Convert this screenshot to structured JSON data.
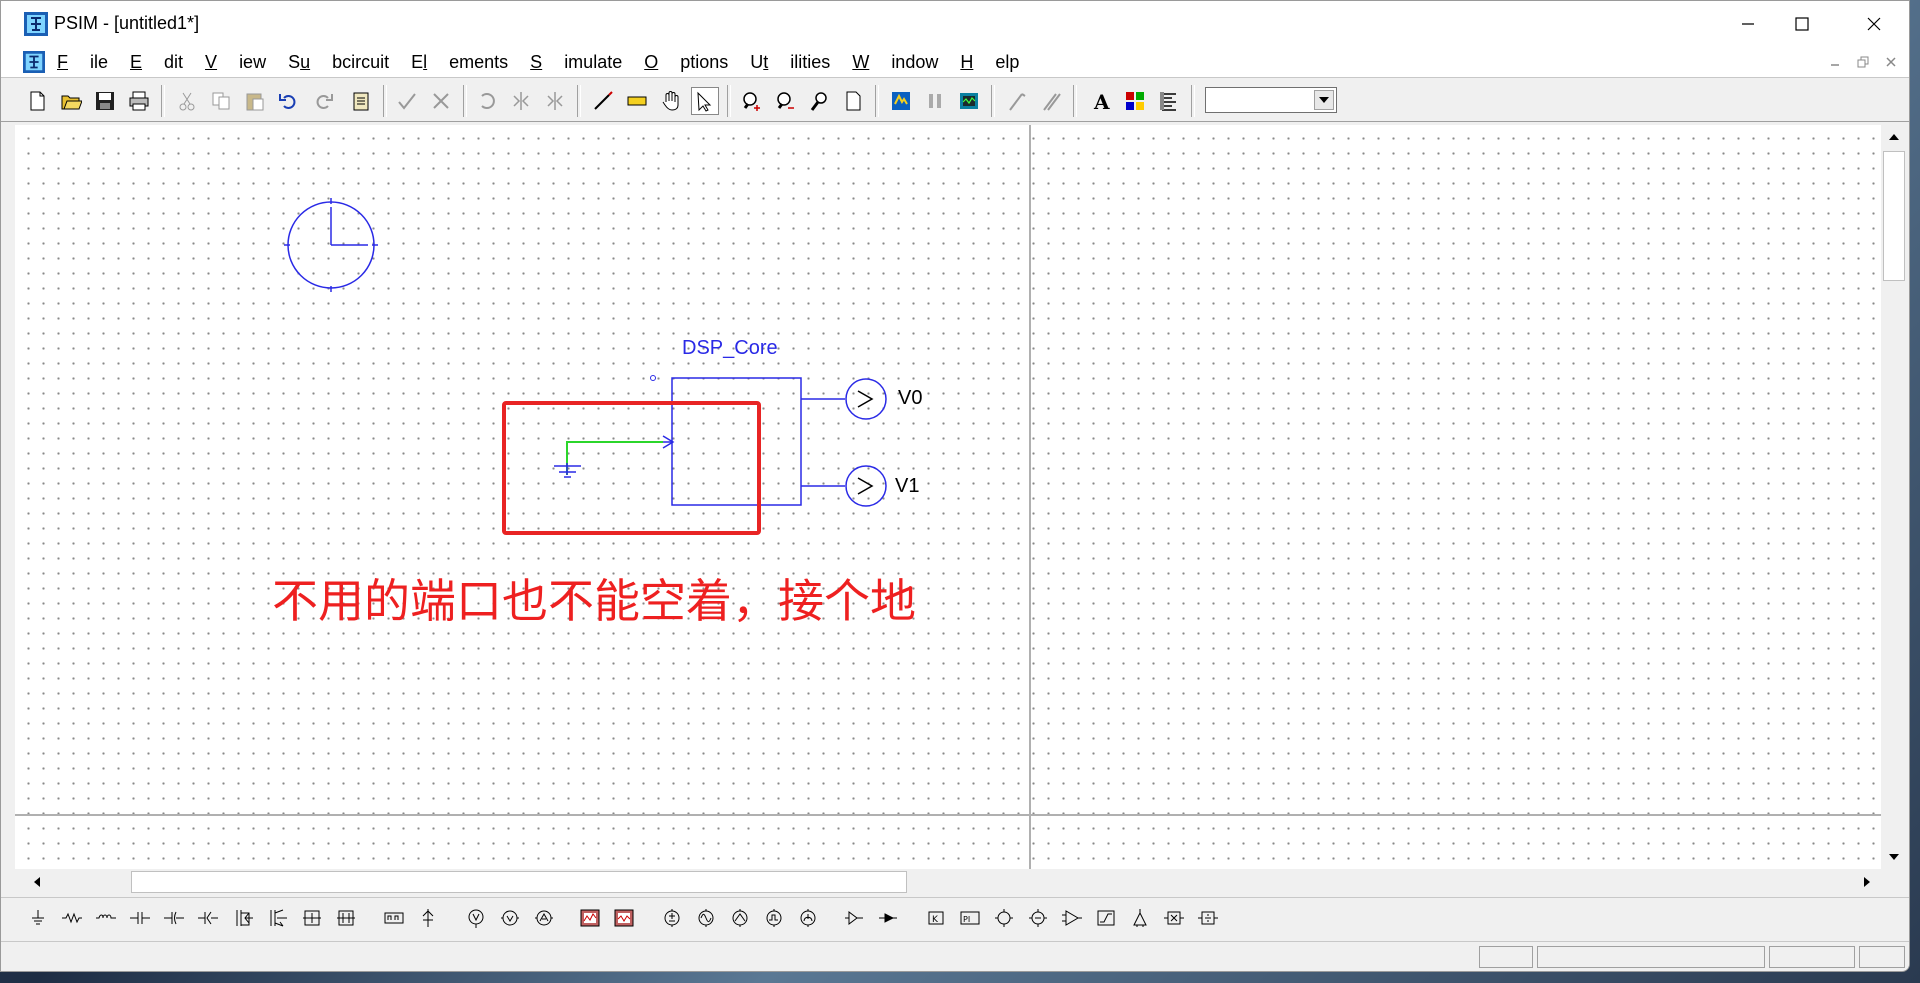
{
  "window": {
    "title": "PSIM - [untitled1*]"
  },
  "menu": {
    "file": "File",
    "edit": "Edit",
    "view": "View",
    "subcircuit": "Subcircuit",
    "elements": "Elements",
    "simulate": "Simulate",
    "options": "Options",
    "utilities": "Utilities",
    "window": "Window",
    "help": "Help"
  },
  "toolbar": {
    "zoom_combo_value": ""
  },
  "schematic": {
    "block_label": "DSP_Core",
    "voltmeter_top_label": "V0",
    "voltmeter_bottom_label": "V1",
    "wire_color": "#2bd62b",
    "element_color": "#2a2ae6"
  },
  "annotation": {
    "text": "不用的端口也不能空着，接个地",
    "color": "#ee2020"
  },
  "icons": {
    "toolbar": [
      "new-file-icon",
      "open-folder-icon",
      "save-icon",
      "print-icon",
      "cut-icon",
      "copy-icon",
      "paste-icon",
      "undo-icon",
      "redo-icon",
      "clipboard-icon",
      "check-icon",
      "cross-icon",
      "rotate-icon",
      "flip-lr-icon",
      "flip-tb-icon",
      "wire-icon",
      "label-icon",
      "pan-hand-icon",
      "select-arrow-icon",
      "zoom-in-icon",
      "zoom-out-icon",
      "zoom-fit-icon",
      "page-icon",
      "run-simulation-icon",
      "pause-icon",
      "scope-icon",
      "probe-v-icon",
      "probe-i-icon",
      "text-icon",
      "element-list-icon",
      "netlist-icon"
    ],
    "elements": [
      "ground-icon",
      "resistor-icon",
      "inductor-icon",
      "capacitor-icon",
      "electrolytic-cap-icon",
      "cap-polar-icon",
      "mosfet-icon",
      "igbt-icon",
      "switch-block-icon",
      "switch-block2-icon",
      "transformer-icon",
      "diode-icon",
      "voltage-probe-icon",
      "dc-voltage-icon",
      "ac-voltage-icon",
      "scope-icon",
      "scope2-icon",
      "dc-source-icon",
      "sine-source-icon",
      "pulse-source-icon",
      "step-source-icon",
      "square-source-icon",
      "gating-block-icon",
      "sensor-icon",
      "gain-block-icon",
      "pi-block-icon",
      "comparator-icon",
      "comparator2-icon",
      "op-amp-icon",
      "limiter-icon",
      "summer-icon",
      "multiplier-icon",
      "divider-icon"
    ]
  }
}
